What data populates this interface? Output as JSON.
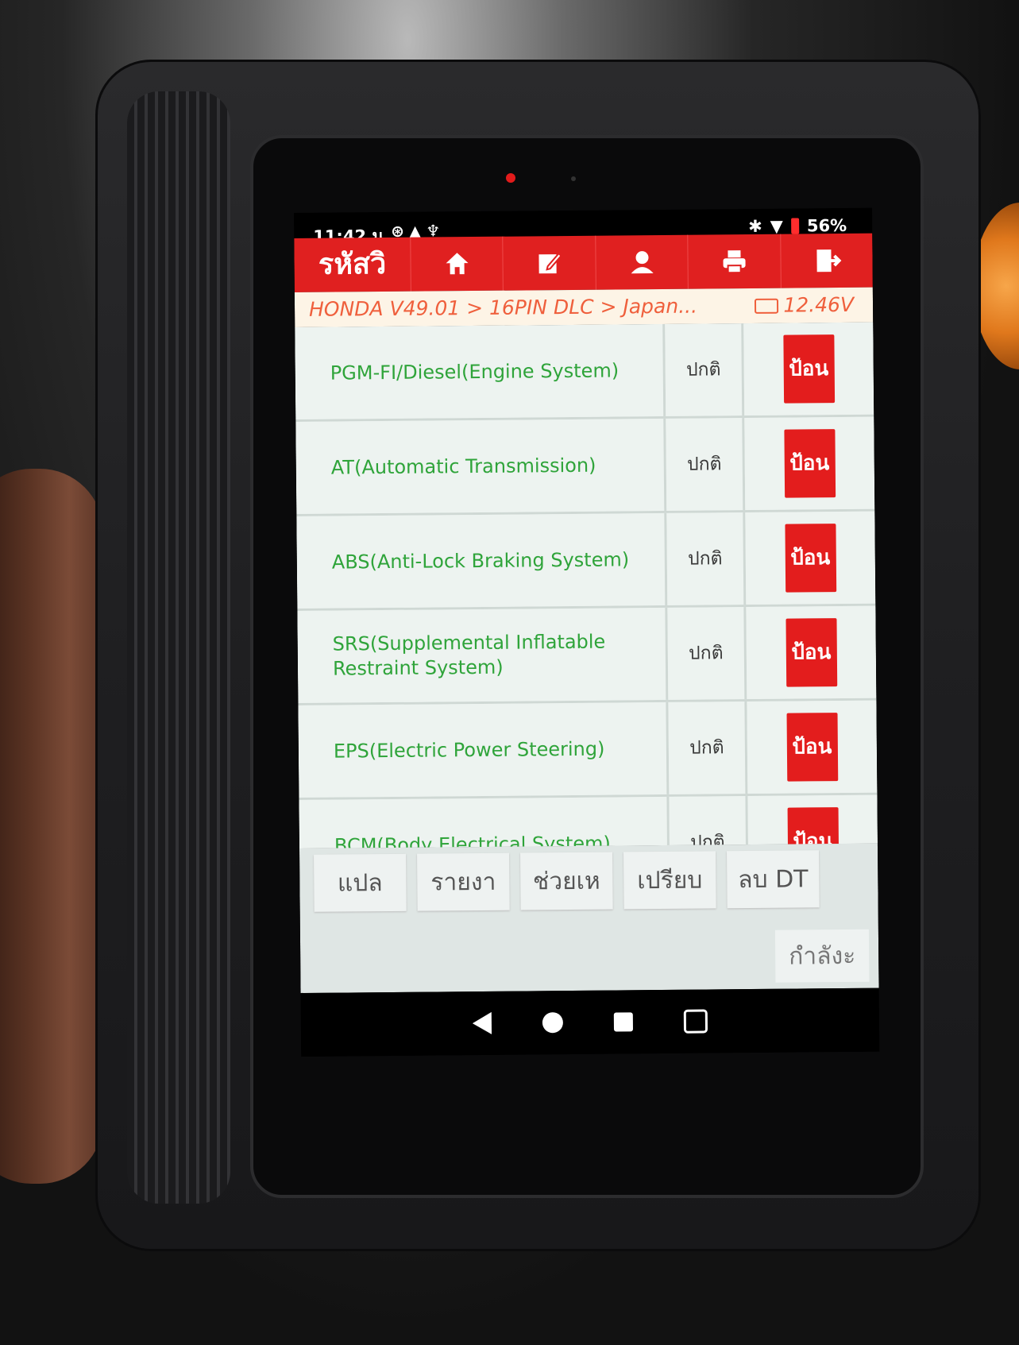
{
  "status_bar": {
    "time": "11:42 น.",
    "battery": "56%"
  },
  "toolbar": {
    "title": "รหัสวิ",
    "buttons": [
      "home-icon",
      "edit-icon",
      "user-icon",
      "print-icon",
      "exit-icon"
    ]
  },
  "breadcrumb": {
    "path": "HONDA V49.01 > 16PIN DLC > Japan...",
    "voltage": "12.46V"
  },
  "systems": [
    {
      "name": "PGM-FI/Diesel(Engine System)",
      "status": "ปกติ",
      "action": "ป้อน"
    },
    {
      "name": "AT(Automatic Transmission)",
      "status": "ปกติ",
      "action": "ป้อน"
    },
    {
      "name": "ABS(Anti-Lock Braking System)",
      "status": "ปกติ",
      "action": "ป้อน"
    },
    {
      "name": "SRS(Supplemental Inflatable Restraint System)",
      "status": "ปกติ",
      "action": "ป้อน"
    },
    {
      "name": "EPS(Electric Power Steering)",
      "status": "ปกติ",
      "action": "ป้อน"
    },
    {
      "name": "BCM(Body Electrical System)",
      "status": "ปกติ",
      "action": "ป้อน"
    }
  ],
  "bottom_buttons": [
    "แปล",
    "รายงา",
    "ช่วยเห",
    "เปรียบ",
    "ลบ DT"
  ],
  "bottom_status_button": "กำลังะ",
  "colors": {
    "accent_red": "#e02020",
    "system_green": "#2fa43a",
    "breadcrumb_orange": "#ef5f3c"
  }
}
